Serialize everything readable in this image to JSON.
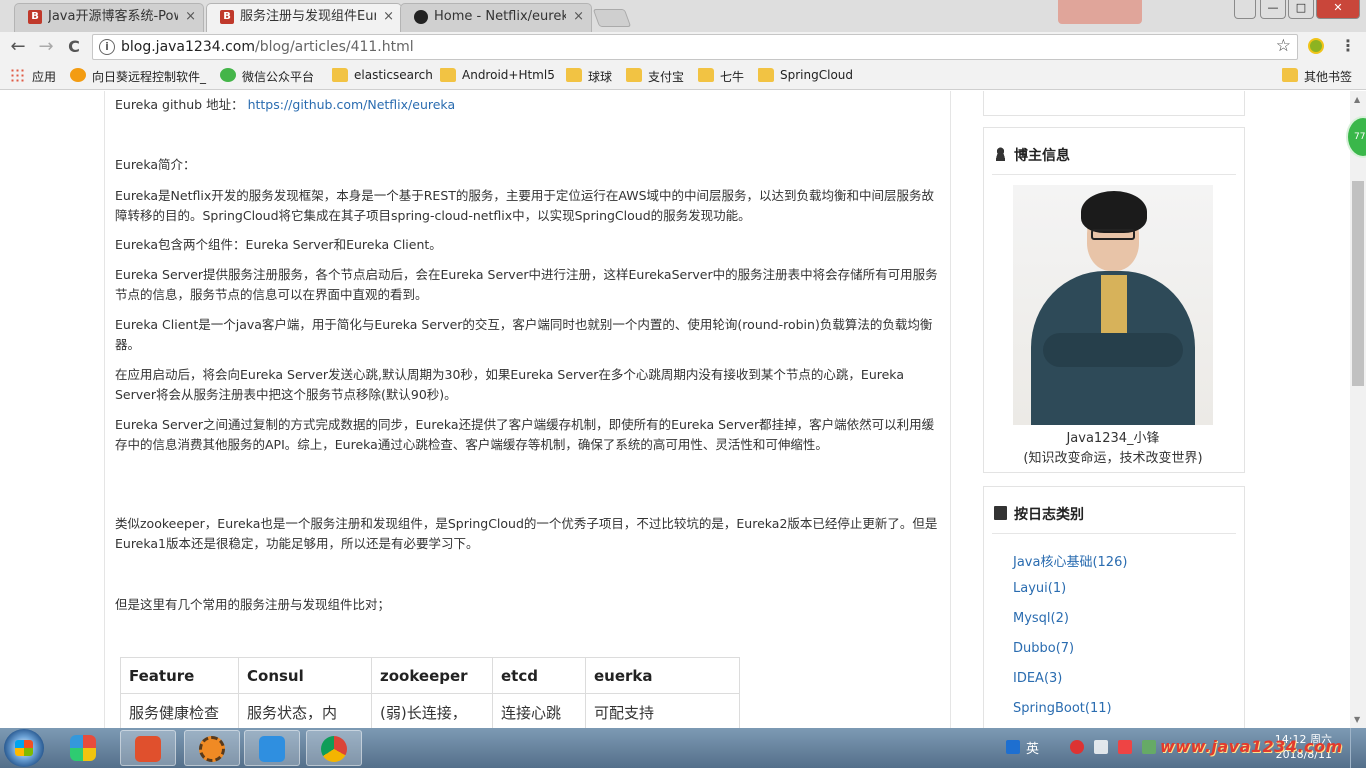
{
  "browser": {
    "tabs": [
      {
        "title": "Java开源博客系统-Pow",
        "favicon": "B",
        "active": false
      },
      {
        "title": "服务注册与发现组件Eure",
        "favicon": "B",
        "active": true
      },
      {
        "title": "Home - Netflix/eureka",
        "favicon": "github-icon",
        "active": false
      }
    ],
    "close_glyph": "×",
    "window_user_label": "",
    "min_glyph": "—",
    "max_glyph": "□",
    "close_win_glyph": "✕",
    "url_host": "blog.java1234.com",
    "url_path": "/blog/articles/411.html",
    "info_glyph": "i",
    "star_glyph": "☆",
    "menu_glyph": "⋮",
    "back_glyph": "←",
    "forward_glyph": "→",
    "reload_glyph": "C"
  },
  "bookmarks": [
    {
      "label": "应用",
      "icon": "apps"
    },
    {
      "label": "向日葵远程控制软件_",
      "icon": "sun"
    },
    {
      "label": "微信公众平台",
      "icon": "wechat"
    },
    {
      "label": "elasticsearch",
      "icon": "folder"
    },
    {
      "label": "Android+Html5",
      "icon": "folder"
    },
    {
      "label": "球球",
      "icon": "folder"
    },
    {
      "label": "支付宝",
      "icon": "folder"
    },
    {
      "label": "七牛",
      "icon": "folder"
    },
    {
      "label": "SpringCloud",
      "icon": "folder"
    },
    {
      "label": "其他书签",
      "icon": "folder"
    }
  ],
  "article": {
    "github_label": "Eureka github 地址：",
    "github_url": "https://github.com/Netflix/eureka",
    "intro_heading": "Eureka简介：",
    "paragraphs": [
      "Eureka是Netflix开发的服务发现框架，本身是一个基于REST的服务，主要用于定位运行在AWS域中的中间层服务，以达到负载均衡和中间层服务故障转移的目的。SpringCloud将它集成在其子项目spring-cloud-netflix中，以实现SpringCloud的服务发现功能。",
      "Eureka包含两个组件：Eureka Server和Eureka Client。",
      "Eureka Server提供服务注册服务，各个节点启动后，会在Eureka Server中进行注册，这样EurekaServer中的服务注册表中将会存储所有可用服务节点的信息，服务节点的信息可以在界面中直观的看到。",
      "Eureka Client是一个java客户端，用于简化与Eureka Server的交互，客户端同时也就别一个内置的、使用轮询(round-robin)负载算法的负载均衡器。",
      "在应用启动后，将会向Eureka Server发送心跳,默认周期为30秒，如果Eureka Server在多个心跳周期内没有接收到某个节点的心跳，Eureka Server将会从服务注册表中把这个服务节点移除(默认90秒)。",
      "Eureka Server之间通过复制的方式完成数据的同步，Eureka还提供了客户端缓存机制，即使所有的Eureka Server都挂掉，客户端依然可以利用缓存中的信息消费其他服务的API。综上，Eureka通过心跳检查、客户端缓存等机制，确保了系统的高可用性、灵活性和可伸缩性。",
      "类似zookeeper，Eureka也是一个服务注册和发现组件，是SpringCloud的一个优秀子项目，不过比较坑的是，Eureka2版本已经停止更新了。但是Eureka1版本还是很稳定，功能足够用，所以还是有必要学习下。",
      "但是这里有几个常用的服务注册与发现组件比对；"
    ],
    "table": {
      "headers": [
        "Feature",
        "Consul",
        "zookeeper",
        "etcd",
        "euerka"
      ],
      "rows": [
        [
          "服务健康检查",
          "服务状态，内",
          "(弱)长连接，",
          "连接心跳",
          "可配支持"
        ]
      ]
    }
  },
  "sidebar": {
    "blogger_heading": "博主信息",
    "blogger_name": "Java1234_小锋",
    "blogger_motto": "(知识改变命运，技术改变世界)",
    "category_heading": "按日志类别",
    "categories": [
      "Java核心基础(126)",
      "Layui(1)",
      "Mysql(2)",
      "Dubbo(7)",
      "IDEA(3)",
      "SpringBoot(11)"
    ],
    "float_button_label": "77"
  },
  "taskbar": {
    "ime_label": "英",
    "clock_time": "14:12 周六",
    "clock_date": "2018/8/11",
    "watermark": "www.java1234.com"
  }
}
